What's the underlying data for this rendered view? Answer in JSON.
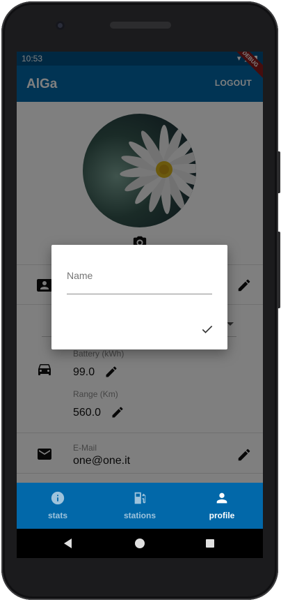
{
  "status_bar": {
    "time": "10:53",
    "icons": "▾ ◢ ▮"
  },
  "app_bar": {
    "title": "AlGa",
    "logout_label": "LOGOUT",
    "debug_banner": "DEBUG"
  },
  "profile": {
    "battery_label": "Battery (kWh)",
    "battery_value": "99.0",
    "range_label": "Range (Km)",
    "range_value": "560.0",
    "email_label": "E-Mail",
    "email_value": "one@one.it"
  },
  "dialog": {
    "field_label": "Name",
    "field_value": ""
  },
  "bottom_nav": {
    "items": [
      {
        "label": "stats",
        "icon": "info-icon",
        "active": false
      },
      {
        "label": "stations",
        "icon": "gas-station-icon",
        "active": false
      },
      {
        "label": "profile",
        "icon": "person-icon",
        "active": true
      }
    ],
    "active_color": "#ffffff",
    "inactive_color": "#9ec3dc"
  },
  "colors": {
    "primary": "#0268a9",
    "status_bar": "#005184",
    "accent_text": "#111111"
  }
}
